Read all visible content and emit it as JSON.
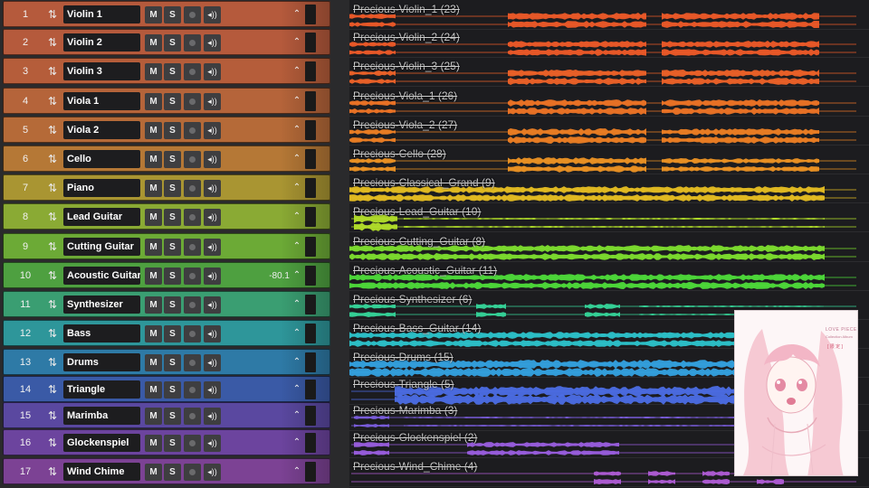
{
  "tracks": [
    {
      "number": "1",
      "name": "Violin 1",
      "mute": "M",
      "solo": "S",
      "volume": "",
      "color": "#b55a3c",
      "waveColor": "#ee5a28",
      "clip": "Precious-Violin_1 (23)",
      "pattern": "orch"
    },
    {
      "number": "2",
      "name": "Violin 2",
      "mute": "M",
      "solo": "S",
      "volume": "",
      "color": "#b55a3c",
      "waveColor": "#ee5a28",
      "clip": "Precious-Violin_2 (24)",
      "pattern": "orch"
    },
    {
      "number": "3",
      "name": "Violin 3",
      "mute": "M",
      "solo": "S",
      "volume": "",
      "color": "#b55d3a",
      "waveColor": "#ee6228",
      "clip": "Precious-Violin_3 (25)",
      "pattern": "orch"
    },
    {
      "number": "4",
      "name": "Viola 1",
      "mute": "M",
      "solo": "S",
      "volume": "",
      "color": "#b5643a",
      "waveColor": "#ee7426",
      "clip": "Precious-Viola_1 (26)",
      "pattern": "orch"
    },
    {
      "number": "5",
      "name": "Viola 2",
      "mute": "M",
      "solo": "S",
      "volume": "",
      "color": "#b56a38",
      "waveColor": "#ee8024",
      "clip": "Precious-Viola_2 (27)",
      "pattern": "orch"
    },
    {
      "number": "6",
      "name": "Cello",
      "mute": "M",
      "solo": "S",
      "volume": "",
      "color": "#b57836",
      "waveColor": "#ee9424",
      "clip": "Precious-Cello (28)",
      "pattern": "cello"
    },
    {
      "number": "7",
      "name": "Piano",
      "mute": "M",
      "solo": "S",
      "volume": "",
      "color": "#a99532",
      "waveColor": "#e8bf22",
      "clip": "Precious-Classical_Grand (9)",
      "pattern": "dense"
    },
    {
      "number": "8",
      "name": "Lead Guitar",
      "mute": "M",
      "solo": "S",
      "volume": "",
      "color": "#8aaa34",
      "waveColor": "#b4e02a",
      "clip": "Precious-Lead_Guitar (10)",
      "pattern": "intro"
    },
    {
      "number": "9",
      "name": "Cutting Guitar",
      "mute": "M",
      "solo": "S",
      "volume": "",
      "color": "#6caa36",
      "waveColor": "#7ee02e",
      "clip": "Precious-Cutting_Guitar (8)",
      "pattern": "dense"
    },
    {
      "number": "10",
      "name": "Acoustic Guitar",
      "mute": "M",
      "solo": "S",
      "volume": "-80.1",
      "color": "#4ea040",
      "waveColor": "#4edc3a",
      "clip": "Precious-Acoustic_Guitar (11)",
      "pattern": "dense"
    },
    {
      "number": "11",
      "name": "Synthesizer",
      "mute": "M",
      "solo": "S",
      "volume": "",
      "color": "#3a9e72",
      "waveColor": "#36d69a",
      "clip": "Precious-Synthesizer (6)",
      "pattern": "synth"
    },
    {
      "number": "12",
      "name": "Bass",
      "mute": "M",
      "solo": "S",
      "volume": "",
      "color": "#2e969a",
      "waveColor": "#2cc4cc",
      "clip": "Precious-Bass_Guitar (14)",
      "pattern": "dense"
    },
    {
      "number": "13",
      "name": "Drums",
      "mute": "M",
      "solo": "S",
      "volume": "",
      "color": "#2e7aa6",
      "waveColor": "#34a2e2",
      "clip": "Precious-Drums (15)",
      "pattern": "drums"
    },
    {
      "number": "14",
      "name": "Triangle",
      "mute": "M",
      "solo": "S",
      "volume": "",
      "color": "#3a5aa6",
      "waveColor": "#4c6ee6",
      "clip": "Precious-Triangle (5)",
      "pattern": "block"
    },
    {
      "number": "15",
      "name": "Marimba",
      "mute": "M",
      "solo": "S",
      "volume": "",
      "color": "#5a48a0",
      "waveColor": "#7c5ee0",
      "clip": "Precious-Marimba (3)",
      "pattern": "sparse"
    },
    {
      "number": "16",
      "name": "Glockenspiel",
      "mute": "M",
      "solo": "S",
      "volume": "",
      "color": "#6c449e",
      "waveColor": "#9a5ee0",
      "clip": "Precious-Glockenspiel (2)",
      "pattern": "glock"
    },
    {
      "number": "17",
      "name": "Wind Chime",
      "mute": "M",
      "solo": "S",
      "volume": "",
      "color": "#7c4294",
      "waveColor": "#b05cd6",
      "clip": "Precious-Wind_Chime (4)",
      "pattern": "chime"
    }
  ],
  "icons": {
    "reorder": "reorder-arrows-icon",
    "record": "record-arm-icon",
    "monitor": "speaker-monitor-icon",
    "automation": "expand-arrows-icon"
  },
  "cover": {
    "title": "LOVE PIECE",
    "subtitle": "Collection Album",
    "badge": "[ 限 定 ]"
  }
}
